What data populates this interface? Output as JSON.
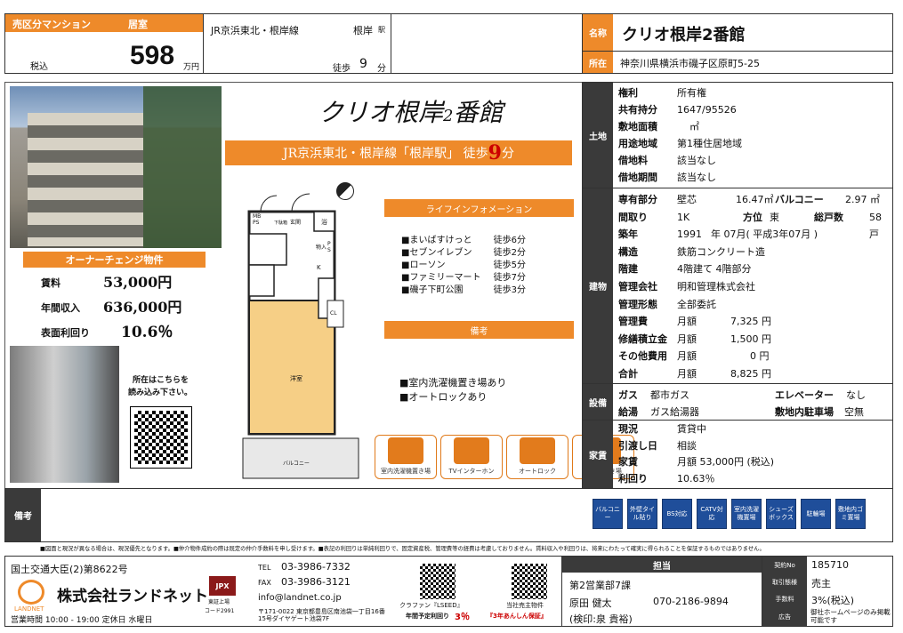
{
  "header": {
    "sale_type": "売区分マンション",
    "status": "居室",
    "tax": "税込",
    "price": "598",
    "price_unit": "万円",
    "line": "JR京浜東北・根岸線",
    "station": "根岸",
    "station_suffix": "駅",
    "walk_label": "徒歩",
    "walk_min": "9",
    "walk_unit": "分",
    "name_label": "名称",
    "name": "クリオ根岸2番館",
    "address_label": "所在",
    "address": "神奈川県横浜市磯子区原町5-25"
  },
  "flyer": {
    "title_main": "クリオ根岸",
    "title_num": "2",
    "title_end": "番館",
    "access_pre": "JR京浜東北・根岸線「根岸駅」 徒歩",
    "access_num": "9",
    "access_post": "分",
    "owner_change": "オーナーチェンジ物件",
    "rent_label": "賃料",
    "rent_value": "53,000円",
    "annual_label": "年間収入",
    "annual_value": "636,000円",
    "yield_label": "表面利回り",
    "yield_value": "10.6％",
    "qr_caption_1": "所在はこちらを",
    "qr_caption_2": "読み込み下さい。",
    "life_header": "ライフインフォメーション",
    "life_items": [
      {
        "name": "■まいばすけっと",
        "walk": "徒歩6分"
      },
      {
        "name": "■セブンイレブン",
        "walk": "徒歩2分"
      },
      {
        "name": "■ローソン",
        "walk": "徒歩5分"
      },
      {
        "name": "■ファミリーマート",
        "walk": "徒歩7分"
      },
      {
        "name": "■磯子下町公園",
        "walk": "徒歩3分"
      }
    ],
    "remarks_header": "備考",
    "remarks": [
      "■室内洗濯機置き場あり",
      "■オートロックあり"
    ],
    "feature_icons": [
      "室内洗濯機置き場",
      "TVインターホン",
      "オートロック",
      "バイク置き場"
    ],
    "floorplan": {
      "mb_ps": "MB\nPS",
      "entrance": "玄関",
      "bath": "浴",
      "k": "K",
      "cl": "CL",
      "western": "洋室",
      "balcony": "バルコニー",
      "storage": "物入",
      "ps": "P\nS",
      "toilet": "下駄箱"
    }
  },
  "land": {
    "section": "土地",
    "rows": [
      {
        "label": "権利",
        "value": "所有権"
      },
      {
        "label": "共有持分",
        "value": "1647/95526"
      },
      {
        "label": "敷地面積",
        "value": "㎡"
      },
      {
        "label": "用途地域",
        "value": "第1種住居地域"
      },
      {
        "label": "借地料",
        "value": "該当なし"
      },
      {
        "label": "借地期間",
        "value": "該当なし"
      }
    ]
  },
  "building": {
    "section": "建物",
    "exclusive_label": "専有部分",
    "exclusive_type": "壁芯",
    "exclusive_area": "16.47㎡",
    "balcony_label": "バルコニー",
    "balcony_area": "2.97 ㎡",
    "layout_label": "間取り",
    "layout": "1K",
    "direction_label": "方位",
    "direction": "東",
    "units_label": "総戸数",
    "units": "58戸",
    "built_label": "築年",
    "built_y": "1991",
    "built_m": "年 07月( 平成3年07月 )",
    "structure_label": "構造",
    "structure": "鉄筋コンクリート造",
    "floor_label": "階建",
    "floor": "4階建て  4階部分",
    "company_label": "管理会社",
    "company": "明和管理株式会社",
    "form_label": "管理形態",
    "form": "全部委託",
    "fees": [
      {
        "label": "管理費",
        "period": "月額",
        "amount": "7,325 円"
      },
      {
        "label": "修繕積立金",
        "period": "月額",
        "amount": "1,500 円"
      },
      {
        "label": "その他費用",
        "period": "月額",
        "amount": "0 円"
      },
      {
        "label": "合計",
        "period": "月額",
        "amount": "8,825 円"
      }
    ]
  },
  "facility": {
    "section": "設備",
    "gas_label": "ガス",
    "gas": "都市ガス",
    "elevator_label": "エレベーター",
    "elevator": "なし",
    "water_label": "給湯",
    "water": "ガス給湯器",
    "parking_label": "敷地内駐車場",
    "parking": "空無"
  },
  "rent": {
    "section": "家賃",
    "status_label": "現況",
    "status": "賃貸中",
    "handover_label": "引渡し日",
    "handover": "相談",
    "rent_label": "家賃",
    "rent": "月額  53,000円 (税込)",
    "yield_label": "利回り",
    "yield": "10.63％"
  },
  "amenity_icons": [
    "バルコニー",
    "外壁タイル貼り",
    "BS対応",
    "CATV対応",
    "室内洗濯機置場",
    "シューズボックス",
    "駐輪場",
    "敷地内ゴミ置場"
  ],
  "remarks_label": "備考",
  "disclaimer": "■図面と現況が異なる場合は、現況優先となります。■仲介物件成約の際は既定の仲介手数料を申し受けます。■表記の利回りは単純利回りで、固定資産税、管理費等の経費は考慮しておりません。賃料収入や利回りは、将来にわたって確実に得られることを保証するものではありません。",
  "company": {
    "license": "国土交通大臣(2)第8622号",
    "name": "株式会社ランドネット",
    "logo": "LANDNET",
    "hours": "営業時間 10:00 - 19:00 定休日 水曜日",
    "jpx": "JPX",
    "jpx_sub": "東証上場",
    "code": "コード2991",
    "tel_label": "TEL",
    "tel": "03-3986-7332",
    "fax_label": "FAX",
    "fax": "03-3986-3121",
    "email": "info@landnet.co.jp",
    "address": "〒171-0022 東京都豊島区南池袋一丁目16番15号ダイヤゲート池袋7F",
    "qr1_caption1": "クラファン『LSEED』",
    "qr1_caption2": "年間予定利回り",
    "qr1_pct": "3％",
    "qr2_caption1": "当社売主物件",
    "qr2_caption2": "『3年あんしん保証』"
  },
  "staff": {
    "header": "担当",
    "dept": "第2営業部7課",
    "name": "原田 健太",
    "phone": "070-2186-9894",
    "checker": "(検印:泉 貴裕)",
    "contract_no_label": "契約No",
    "contract_no": "185710",
    "deal_label": "取引態様",
    "deal": "売主",
    "fee_label": "手数料",
    "fee": "3%(税込)",
    "ad_label": "広告",
    "ad": "御社ホームページのみ掲載可能です"
  },
  "colors": {
    "accent": "#ee8a2a",
    "dark": "#3a3a3a",
    "icon_blue": "#1f4e9a"
  }
}
